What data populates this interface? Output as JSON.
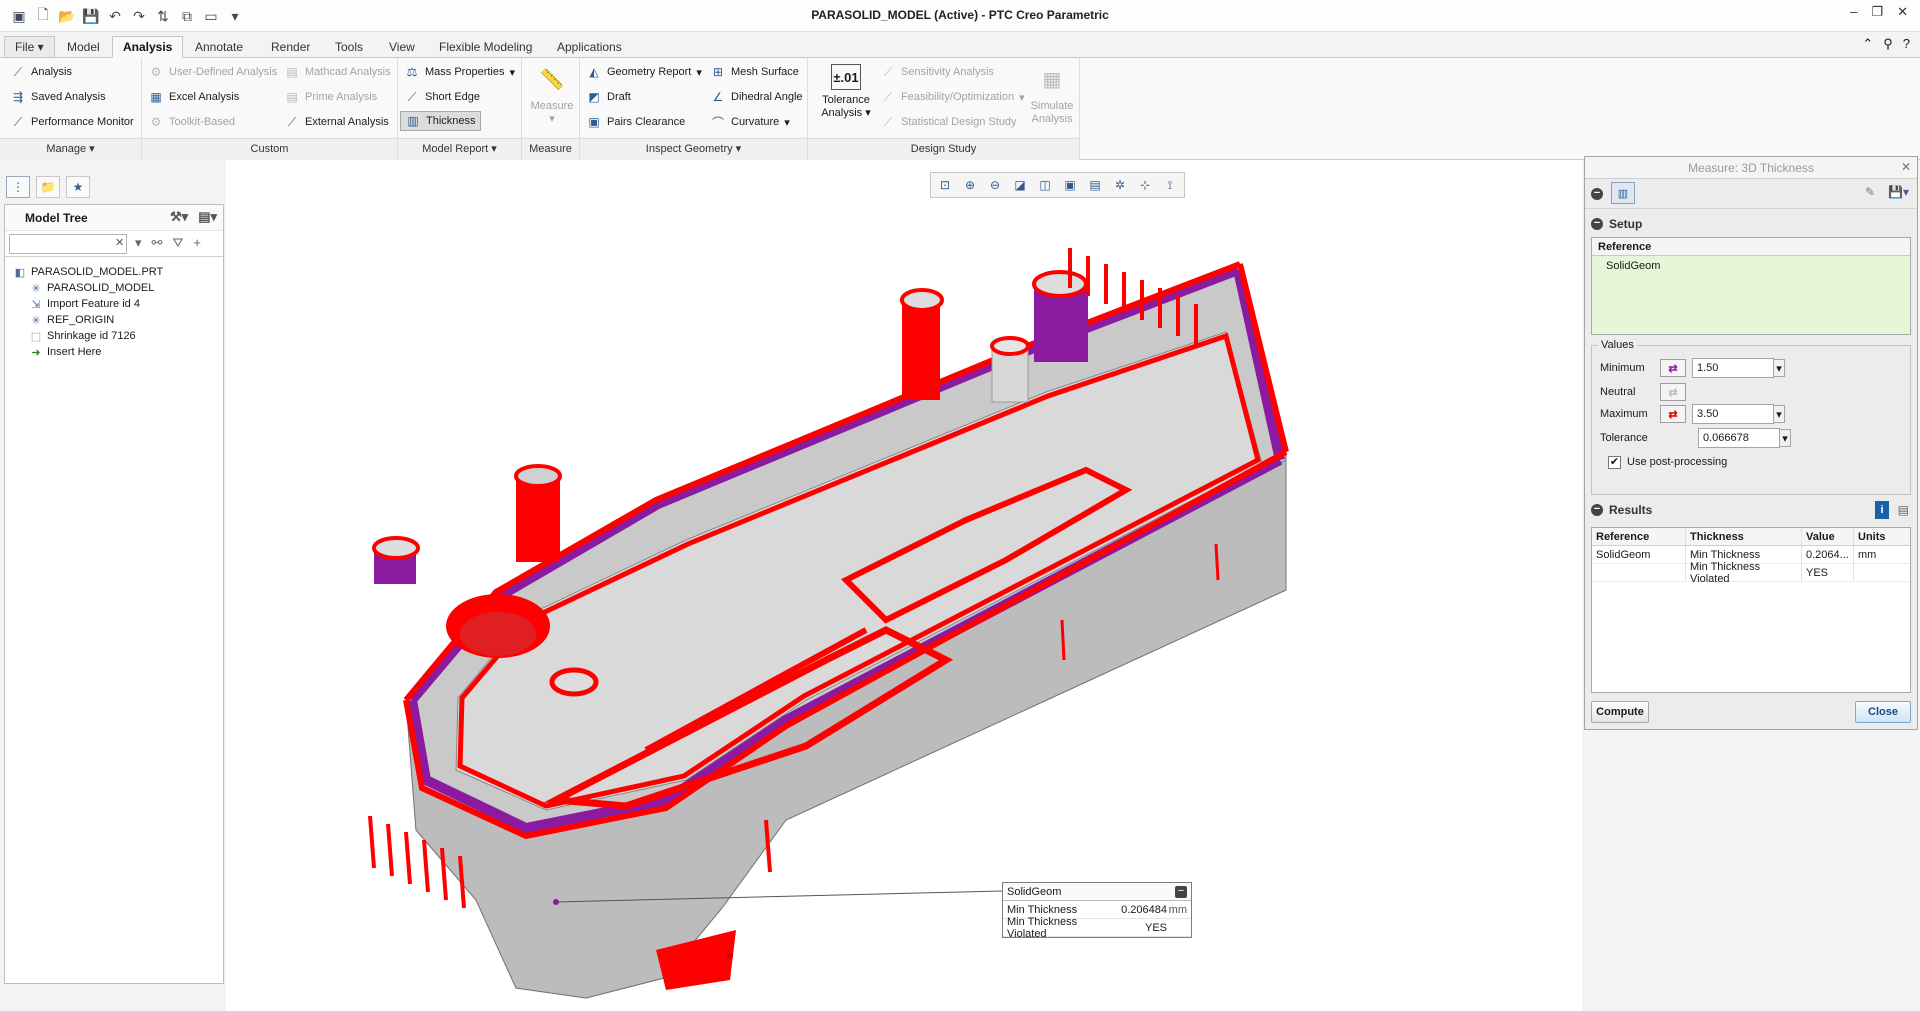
{
  "window": {
    "title": "PARASOLID_MODEL (Active) - PTC Creo Parametric"
  },
  "tabs": [
    "File ▾",
    "Model",
    "Analysis",
    "Annotate",
    "Render",
    "Tools",
    "View",
    "Flexible Modeling",
    "Applications"
  ],
  "active_tab": "Analysis",
  "ribbon": {
    "manage": {
      "analysis": "Analysis",
      "saved_analysis": "Saved Analysis",
      "performance_monitor": "Performance Monitor",
      "footer": "Manage ▾"
    },
    "custom": {
      "user_defined": "User-Defined Analysis",
      "excel": "Excel Analysis",
      "toolkit": "Toolkit-Based",
      "mathcad": "Mathcad Analysis",
      "prime": "Prime Analysis",
      "external": "External Analysis",
      "footer": "Custom"
    },
    "model_report": {
      "mass_properties": "Mass Properties",
      "short_edge": "Short Edge",
      "thickness": "Thickness",
      "footer": "Model Report ▾"
    },
    "measure": {
      "label": "Measure",
      "footer": "Measure"
    },
    "inspect_geometry": {
      "geometry_report": "Geometry Report",
      "draft": "Draft",
      "pairs_clearance": "Pairs Clearance",
      "mesh_surface": "Mesh Surface",
      "dihedral_angle": "Dihedral Angle",
      "curvature": "Curvature",
      "footer": "Inspect Geometry ▾"
    },
    "design_study": {
      "tolerance_icon": "±.01",
      "tolerance_l1": "Tolerance",
      "tolerance_l2": "Analysis",
      "sensitivity": "Sensitivity Analysis",
      "feasibility": "Feasibility/Optimization",
      "statistical": "Statistical Design Study",
      "simulate_l1": "Simulate",
      "simulate_l2": "Analysis",
      "footer": "Design Study"
    }
  },
  "model_tree": {
    "title": "Model Tree",
    "search_value": "",
    "items": [
      {
        "label": "PARASOLID_MODEL.PRT",
        "icon": "part-icon"
      },
      {
        "label": "PARASOLID_MODEL",
        "icon": "csys-icon"
      },
      {
        "label": "Import Feature id 4",
        "icon": "import-feature-icon"
      },
      {
        "label": "REF_ORIGIN",
        "icon": "csys-icon"
      },
      {
        "label": "Shrinkage id 7126",
        "icon": "shrinkage-icon"
      },
      {
        "label": "Insert Here",
        "icon": "insert-arrow-icon"
      }
    ]
  },
  "annotation": {
    "title": "SolidGeom",
    "rows": [
      {
        "label": "Min Thickness",
        "value": "0.206484",
        "unit": "mm"
      },
      {
        "label": "Min Thickness Violated",
        "value": "YES",
        "unit": ""
      }
    ]
  },
  "dialog": {
    "title": "Measure: 3D Thickness",
    "setup_label": "Setup",
    "reference_header": "Reference",
    "reference_value": "SolidGeom",
    "values_legend": "Values",
    "minimum_label": "Minimum",
    "minimum_value": "1.50",
    "neutral_label": "Neutral",
    "maximum_label": "Maximum",
    "maximum_value": "3.50",
    "tolerance_label": "Tolerance",
    "tolerance_value": "0.066678",
    "post_processing_label": "Use post-processing",
    "post_processing_checked": true,
    "results_label": "Results",
    "results_columns": [
      "Reference",
      "Thickness",
      "Value",
      "Units"
    ],
    "results_rows": [
      [
        "SolidGeom",
        "Min Thickness",
        "0.2064...",
        "mm"
      ],
      [
        "",
        "Min Thickness Violated",
        "YES",
        ""
      ]
    ],
    "compute_label": "Compute",
    "close_label": "Close"
  },
  "colors": {
    "thick_region": "#ff0000",
    "thin_region": "#8a1aa0",
    "model_gray": "#c9c9c9"
  }
}
